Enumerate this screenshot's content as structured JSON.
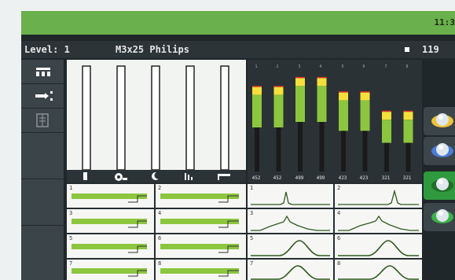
{
  "status_bar": {
    "time": "11:3"
  },
  "info_bar": {
    "level_label": "Level: 1",
    "screw_name": "M3x25 Philips",
    "count": "119"
  },
  "left_nav": {
    "items": [
      {
        "icon": "layout-icon"
      },
      {
        "icon": "branch-icon"
      },
      {
        "icon": "document-icon"
      },
      {
        "icon": "blank"
      },
      {
        "icon": "blank"
      }
    ]
  },
  "bar_panel": {
    "icons": [
      "battery-icon",
      "gear-icon",
      "moon-icon",
      "bar-chart-icon",
      "ruler-icon"
    ]
  },
  "mini_cells": [
    {
      "label": "1"
    },
    {
      "label": "2"
    },
    {
      "label": "3"
    },
    {
      "label": "4"
    },
    {
      "label": "5"
    },
    {
      "label": "6"
    },
    {
      "label": "7"
    },
    {
      "label": "8"
    }
  ],
  "histogram": {
    "top_numbers": [
      "1",
      "2",
      "3",
      "4",
      "5",
      "6",
      "7",
      "8"
    ],
    "values": [
      "452",
      "452",
      "499",
      "499",
      "423",
      "423",
      "321",
      "321"
    ],
    "levels": [
      452,
      452,
      499,
      499,
      423,
      423,
      321,
      321
    ],
    "colors": {
      "yellow": "#f4e03a",
      "green": "#8cc63f",
      "dark": "#1a1a1a",
      "red": "#e5332a"
    }
  },
  "wave_cells": [
    {
      "label": "1"
    },
    {
      "label": "2"
    },
    {
      "label": "3"
    },
    {
      "label": "4"
    },
    {
      "label": "5"
    },
    {
      "label": "6"
    },
    {
      "label": "7"
    },
    {
      "label": "8"
    }
  ],
  "side_actions": [
    {
      "icon": "orb-yellow-icon",
      "accent": "#f0c23a"
    },
    {
      "icon": "orb-blue-icon",
      "accent": "#4a7bd6"
    },
    {
      "icon": "orb-green-icon",
      "accent": "#2e9a3a"
    },
    {
      "icon": "orb-green-icon",
      "accent": "#3bb14a"
    }
  ],
  "colors": {
    "accent": "#6ab04c",
    "panel": "#1f272a"
  }
}
